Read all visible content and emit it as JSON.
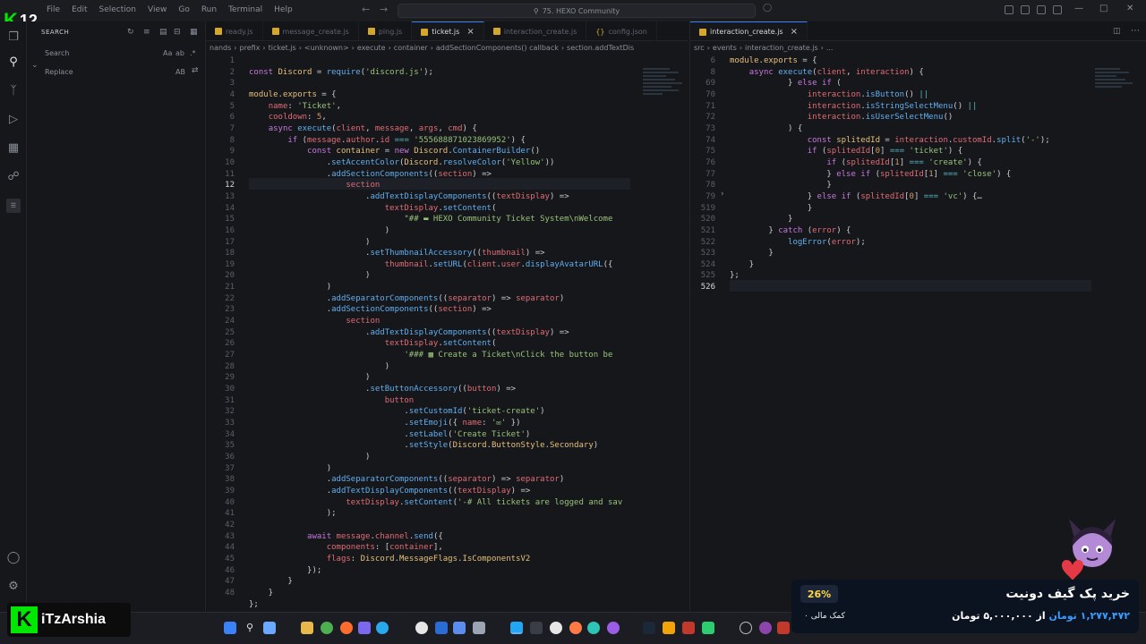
{
  "app": {
    "window_title": "75. HEXO Community",
    "menu": [
      "File",
      "Edit",
      "Selection",
      "View",
      "Go",
      "Run",
      "Terminal",
      "Help"
    ]
  },
  "sidebar": {
    "header": "SEARCH",
    "search_placeholder": "Search",
    "replace_placeholder": "Replace",
    "opt_case": "Aa",
    "opt_word": "ab",
    "opt_regex": ".*",
    "opt_replace_all": "AB"
  },
  "left_editor": {
    "tabs": [
      {
        "label": "ready.js",
        "icon": "js-file-icon"
      },
      {
        "label": "message_create.js",
        "icon": "js-file-icon"
      },
      {
        "label": "ping.js",
        "icon": "js-file-icon"
      },
      {
        "label": "ticket.js",
        "icon": "js-file-icon",
        "active": true
      },
      {
        "label": "interaction_create.js",
        "icon": "js-file-icon"
      },
      {
        "label": "config.json",
        "icon": "json-file-icon"
      }
    ],
    "breadcrumbs": [
      "nands",
      "prefix",
      "ticket.js",
      "<unknown>",
      "execute",
      "container",
      "addSectionComponents() callback",
      "section.addTextDis"
    ],
    "cursor_line": 12,
    "line_numbers": [
      1,
      2,
      3,
      4,
      5,
      6,
      7,
      8,
      9,
      10,
      11,
      12,
      13,
      14,
      15,
      16,
      17,
      18,
      19,
      20,
      21,
      22,
      23,
      24,
      25,
      26,
      27,
      28,
      29,
      30,
      31,
      32,
      33,
      34,
      35,
      36,
      37,
      38,
      39,
      40,
      41,
      42,
      43,
      44,
      45,
      46,
      47,
      48
    ]
  },
  "right_editor": {
    "tab_label": "interaction_create.js",
    "breadcrumbs": [
      "src",
      "events",
      "interaction_create.js",
      "..."
    ],
    "line_numbers": [
      "6",
      "8",
      "69",
      "70",
      "71",
      "72",
      "73",
      "74",
      "75",
      "76",
      "77",
      "78",
      "79",
      "519",
      "520",
      "521",
      "522",
      "523",
      "524",
      "525",
      "526"
    ],
    "folded_text": "…"
  },
  "overlay": {
    "logo_k": "K",
    "logo_number": "12",
    "brand_name": "iTzArshia",
    "donate_title": "خرید پک گیف دونیت",
    "donate_amount_raised": "۱,۲۷۷,۴۷۲ تومان",
    "donate_amount_goal": "از ۵,۰۰۰,۰۰۰ تومان",
    "donate_percent": "26%",
    "donate_supporters": "۰ کمک مالی"
  },
  "colors": {
    "accent": "#3b82f6",
    "brand_green": "#00e701",
    "donate_highlight": "#3b9cff"
  }
}
